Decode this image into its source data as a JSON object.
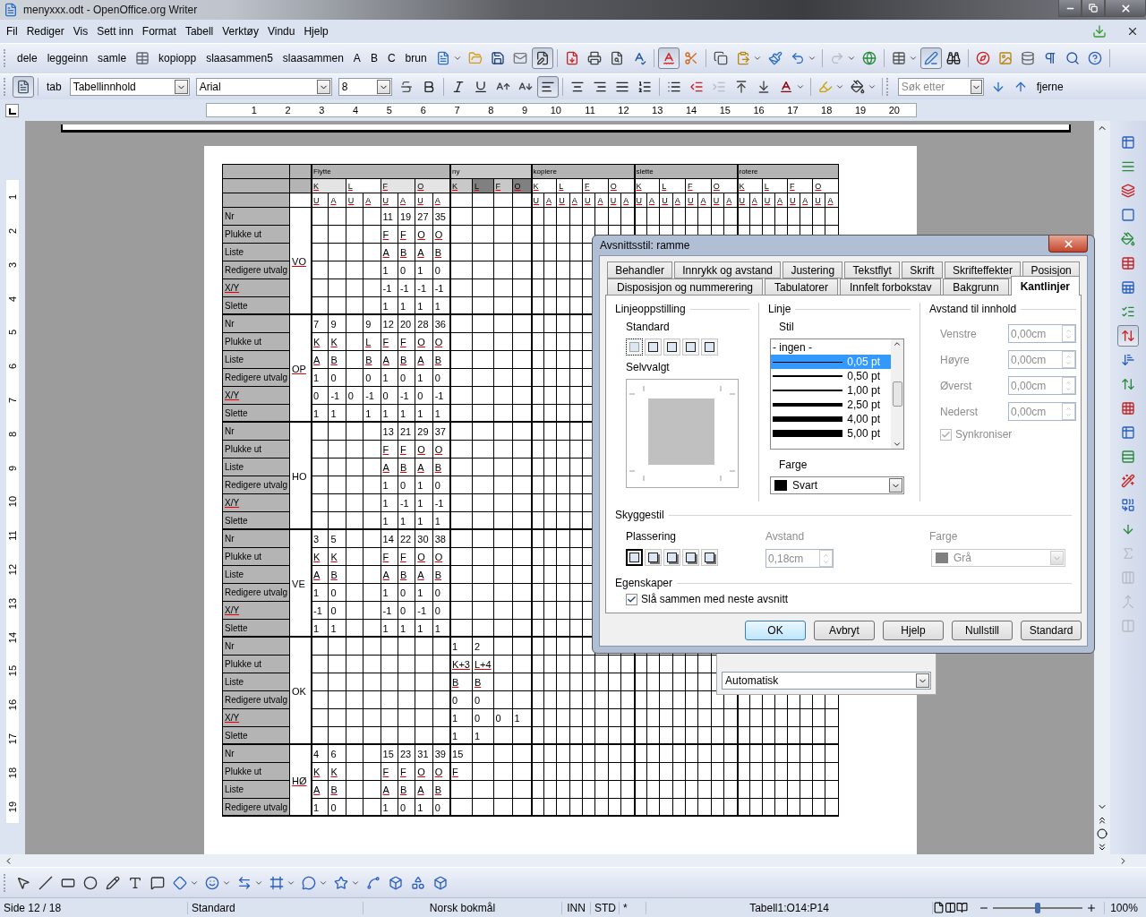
{
  "window": {
    "title": "menyxxx.odt - OpenOffice.org Writer"
  },
  "menu": [
    "Fil",
    "Rediger",
    "Vis",
    "Sett inn",
    "Format",
    "Tabell",
    "Verktøy",
    "Vindu",
    "Hjelp"
  ],
  "toolbar_1": {
    "text_buttons_a": [
      "dele",
      "leggeinn",
      "samle"
    ],
    "text_buttons_b": [
      "kopiopp",
      "slaasammen5",
      "slaasammen",
      "A",
      "B",
      "C",
      "brun"
    ],
    "icon_buttons": [
      {
        "on": false,
        "disabled": false
      },
      {
        "on": false,
        "disabled": false
      },
      {
        "on": false,
        "disabled": false
      },
      {
        "on": false,
        "disabled": false
      },
      {
        "on": true,
        "disabled": false
      },
      {
        "on": false,
        "disabled": false
      },
      {
        "on": false,
        "disabled": false
      },
      {
        "on": false,
        "disabled": false
      },
      {
        "on": false,
        "disabled": false
      },
      {
        "on": true,
        "disabled": false
      },
      {
        "on": false,
        "disabled": false
      },
      {
        "on": false,
        "disabled": false
      },
      {
        "on": false,
        "disabled": false
      },
      {
        "on": false,
        "disabled": false
      },
      {
        "on": false,
        "disabled": false
      },
      {
        "on": false,
        "disabled": true
      },
      {
        "on": false,
        "disabled": false
      },
      {
        "on": false,
        "disabled": false
      },
      {
        "on": true,
        "disabled": false
      },
      {
        "on": false,
        "disabled": false
      },
      {
        "on": false,
        "disabled": false
      },
      {
        "on": false,
        "disabled": false
      },
      {
        "on": false,
        "disabled": false
      },
      {
        "on": false,
        "disabled": false
      },
      {
        "on": false,
        "disabled": false
      },
      {
        "on": false,
        "disabled": false
      }
    ]
  },
  "toolbar_2": {
    "first_button_on": true,
    "tool_label": "tab",
    "style": "Tabellinnhold",
    "font": "Arial",
    "size": "8",
    "icon_buttons": [
      {
        "on": false,
        "disabled": false
      },
      {
        "on": false,
        "disabled": false
      },
      {
        "on": false,
        "disabled": false
      },
      {
        "on": false,
        "disabled": false
      },
      {
        "on": false,
        "disabled": false
      },
      {
        "on": false,
        "disabled": false
      },
      {
        "on": true,
        "disabled": false
      },
      {
        "on": false,
        "disabled": false
      },
      {
        "on": false,
        "disabled": false
      },
      {
        "on": false,
        "disabled": false
      },
      {
        "on": false,
        "disabled": false
      },
      {
        "on": false,
        "disabled": false
      },
      {
        "on": false,
        "disabled": false
      },
      {
        "on": false,
        "disabled": true
      },
      {
        "on": false,
        "disabled": false
      },
      {
        "on": false,
        "disabled": false
      },
      {
        "on": false,
        "disabled": false
      },
      {
        "on": false,
        "disabled": false
      },
      {
        "on": false,
        "disabled": false
      }
    ]
  },
  "find_toolbar": {
    "placeholder": "Søk etter",
    "button": "fjerne"
  },
  "ruler": {
    "labels": [
      "1",
      "2",
      "3",
      "4",
      "5",
      "6",
      "7",
      "8",
      "9",
      "10",
      "11",
      "12",
      "13",
      "14",
      "15",
      "16",
      "17",
      "18",
      "19",
      "20"
    ]
  },
  "vertical_ruler": {
    "labels": [
      "1",
      "2",
      "3",
      "4",
      "5",
      "6",
      "7",
      "8",
      "9",
      "10",
      "11",
      "12",
      "13",
      "14",
      "15",
      "16",
      "17",
      "18",
      "19"
    ]
  },
  "table": {
    "groups": [
      {
        "label": "Flytte",
        "subgroups": [
          {
            "label": "K",
            "kind": "light",
            "halves": [
              "U",
              "A"
            ]
          },
          {
            "label": "L",
            "kind": "white",
            "halves": [
              "U",
              "A"
            ]
          },
          {
            "label": "F",
            "kind": "light",
            "halves": [
              "U",
              "A"
            ]
          },
          {
            "label": "O",
            "kind": "light",
            "halves": [
              "U",
              "A"
            ]
          }
        ]
      },
      {
        "label": "ny",
        "subgroups": [
          {
            "label": "K",
            "kind": "mid"
          },
          {
            "label": "L",
            "kind": "dark"
          },
          {
            "label": "F",
            "kind": "mid"
          },
          {
            "label": "O",
            "kind": "dark"
          }
        ]
      },
      {
        "label": "kopiere",
        "subgroups": [
          {
            "label": "K",
            "kind": "white",
            "halves": [
              "U",
              "A"
            ]
          },
          {
            "label": "L",
            "kind": "white",
            "halves": [
              "U",
              "A"
            ]
          },
          {
            "label": "F",
            "kind": "white",
            "halves": [
              "U",
              "A"
            ]
          },
          {
            "label": "O",
            "kind": "white",
            "halves": [
              "U",
              "A"
            ]
          }
        ]
      },
      {
        "label": "slette",
        "subgroups": [
          {
            "label": "K",
            "kind": "white",
            "halves": [
              "U",
              "A"
            ]
          },
          {
            "label": "L",
            "kind": "white",
            "halves": [
              "U",
              "A"
            ]
          },
          {
            "label": "F",
            "kind": "white",
            "halves": [
              "U",
              "A"
            ]
          },
          {
            "label": "O",
            "kind": "white",
            "halves": [
              "U",
              "A"
            ]
          }
        ]
      },
      {
        "label": "rotere",
        "subgroups": [
          {
            "label": "K",
            "kind": "white",
            "halves": [
              "U",
              "A"
            ]
          },
          {
            "label": "L",
            "kind": "white",
            "halves": [
              "U",
              "A"
            ]
          },
          {
            "label": "F",
            "kind": "white",
            "halves": [
              "U",
              "A"
            ]
          },
          {
            "label": "O",
            "kind": "white",
            "halves": [
              "U",
              "A"
            ]
          }
        ]
      }
    ],
    "sections": [
      {
        "label": "VO",
        "spellcheck": true,
        "rows": [
          {
            "label": "Nr",
            "label_spellcheck": false,
            "cells_spellcheck": false,
            "cells": [
              null,
              null,
              null,
              null,
              "11",
              "19",
              "27",
              "35"
            ]
          },
          {
            "label": "Plukke ut",
            "label_spellcheck": false,
            "cells_spellcheck": true,
            "cells": [
              null,
              null,
              null,
              null,
              "F",
              "F",
              "O",
              "O"
            ]
          },
          {
            "label": "Liste",
            "label_spellcheck": false,
            "cells_spellcheck": true,
            "cells": [
              null,
              null,
              null,
              null,
              "A",
              "B",
              "A",
              "B"
            ]
          },
          {
            "label": "Redigere utvalg",
            "label_spellcheck": false,
            "cells_spellcheck": false,
            "cells": [
              null,
              null,
              null,
              null,
              "1",
              "0",
              "1",
              "0"
            ]
          },
          {
            "label": "X/Y",
            "label_spellcheck": true,
            "cells_spellcheck": false,
            "cells": [
              null,
              null,
              null,
              null,
              "-1",
              "-1",
              "-1",
              "-1"
            ]
          },
          {
            "label": "Slette",
            "label_spellcheck": false,
            "cells_spellcheck": false,
            "cells": [
              null,
              null,
              null,
              null,
              "1",
              "1",
              "1",
              "1"
            ]
          }
        ]
      },
      {
        "label": "OP",
        "spellcheck": true,
        "rows": [
          {
            "label": "Nr",
            "label_spellcheck": false,
            "cells_spellcheck": false,
            "cells": [
              "7",
              "9",
              null,
              "9",
              "12",
              "20",
              "28",
              "36"
            ]
          },
          {
            "label": "Plukke ut",
            "label_spellcheck": false,
            "cells_spellcheck": true,
            "cells": [
              "K",
              "K",
              null,
              "L",
              "F",
              "F",
              "O",
              "O"
            ]
          },
          {
            "label": "Liste",
            "label_spellcheck": false,
            "cells_spellcheck": true,
            "cells": [
              "A",
              "B",
              null,
              "B",
              "A",
              "B",
              "A",
              "B"
            ]
          },
          {
            "label": "Redigere utvalg",
            "label_spellcheck": false,
            "cells_spellcheck": false,
            "cells": [
              "1",
              "0",
              null,
              "0",
              "1",
              "0",
              "1",
              "0"
            ]
          },
          {
            "label": "X/Y",
            "label_spellcheck": true,
            "cells_spellcheck": false,
            "cells": [
              "0",
              "-1",
              "0",
              "-1",
              "0",
              "-1",
              "0",
              "-1"
            ]
          },
          {
            "label": "Slette",
            "label_spellcheck": false,
            "cells_spellcheck": false,
            "cells": [
              "1",
              "1",
              null,
              "1",
              "1",
              "1",
              "1",
              "1"
            ]
          }
        ]
      },
      {
        "label": "HO",
        "spellcheck": false,
        "rows": [
          {
            "label": "Nr",
            "label_spellcheck": false,
            "cells_spellcheck": false,
            "cells": [
              null,
              null,
              null,
              null,
              "13",
              "21",
              "29",
              "37"
            ]
          },
          {
            "label": "Plukke ut",
            "label_spellcheck": false,
            "cells_spellcheck": true,
            "cells": [
              null,
              null,
              null,
              null,
              "F",
              "F",
              "O",
              "O"
            ]
          },
          {
            "label": "Liste",
            "label_spellcheck": false,
            "cells_spellcheck": true,
            "cells": [
              null,
              null,
              null,
              null,
              "A",
              "B",
              "A",
              "B"
            ]
          },
          {
            "label": "Redigere utvalg",
            "label_spellcheck": false,
            "cells_spellcheck": false,
            "cells": [
              null,
              null,
              null,
              null,
              "1",
              "0",
              "1",
              "0"
            ]
          },
          {
            "label": "X/Y",
            "label_spellcheck": true,
            "cells_spellcheck": false,
            "cells": [
              null,
              null,
              null,
              null,
              "1",
              "-1",
              "1",
              "-1"
            ]
          },
          {
            "label": "Slette",
            "label_spellcheck": false,
            "cells_spellcheck": false,
            "cells": [
              null,
              null,
              null,
              null,
              "1",
              "1",
              "1",
              "1"
            ]
          }
        ]
      },
      {
        "label": "VE",
        "spellcheck": false,
        "rows": [
          {
            "label": "Nr",
            "label_spellcheck": false,
            "cells_spellcheck": false,
            "cells": [
              "3",
              "5",
              null,
              null,
              "14",
              "22",
              "30",
              "38"
            ]
          },
          {
            "label": "Plukke ut",
            "label_spellcheck": false,
            "cells_spellcheck": true,
            "cells": [
              "K",
              "K",
              null,
              null,
              "F",
              "F",
              "O",
              "O"
            ]
          },
          {
            "label": "Liste",
            "label_spellcheck": false,
            "cells_spellcheck": true,
            "cells": [
              "A",
              "B",
              null,
              null,
              "A",
              "B",
              "A",
              "B"
            ]
          },
          {
            "label": "Redigere utvalg",
            "label_spellcheck": false,
            "cells_spellcheck": false,
            "cells": [
              "1",
              "0",
              null,
              null,
              "1",
              "0",
              "1",
              "0"
            ]
          },
          {
            "label": "X/Y",
            "label_spellcheck": true,
            "cells_spellcheck": false,
            "cells": [
              "-1",
              "0",
              null,
              null,
              "-1",
              "0",
              "-1",
              "0"
            ]
          },
          {
            "label": "Slette",
            "label_spellcheck": false,
            "cells_spellcheck": false,
            "cells": [
              "1",
              "1",
              null,
              null,
              "1",
              "1",
              "1",
              "1"
            ]
          }
        ]
      },
      {
        "label": "OK",
        "spellcheck": false,
        "rows": [
          {
            "label": "Nr",
            "label_spellcheck": false,
            "cells_spellcheck": false,
            "cells": [
              null,
              null,
              null,
              null,
              null,
              null,
              null,
              null,
              "1",
              "2"
            ]
          },
          {
            "label": "Plukke ut",
            "label_spellcheck": false,
            "cells_spellcheck": true,
            "cells": [
              null,
              null,
              null,
              null,
              null,
              null,
              null,
              null,
              "K+3",
              "L+4"
            ]
          },
          {
            "label": "Liste",
            "label_spellcheck": false,
            "cells_spellcheck": true,
            "cells": [
              null,
              null,
              null,
              null,
              null,
              null,
              null,
              null,
              "B",
              "B"
            ]
          },
          {
            "label": "Redigere utvalg",
            "label_spellcheck": false,
            "cells_spellcheck": false,
            "cells": [
              null,
              null,
              null,
              null,
              null,
              null,
              null,
              null,
              "0",
              "0"
            ]
          },
          {
            "label": "X/Y",
            "label_spellcheck": true,
            "cells_spellcheck": false,
            "cells": [
              null,
              null,
              null,
              null,
              null,
              null,
              null,
              null,
              "1",
              "0",
              "0",
              "1"
            ]
          },
          {
            "label": "Slette",
            "label_spellcheck": false,
            "cells_spellcheck": false,
            "cells": [
              null,
              null,
              null,
              null,
              null,
              null,
              null,
              null,
              "1",
              "1"
            ]
          }
        ]
      },
      {
        "label": "HØ",
        "spellcheck": true,
        "rows": [
          {
            "label": "Nr",
            "label_spellcheck": false,
            "cells_spellcheck": false,
            "cells": [
              "4",
              "6",
              null,
              null,
              "15",
              "23",
              "31",
              "39",
              "15"
            ]
          },
          {
            "label": "Plukke ut",
            "label_spellcheck": false,
            "cells_spellcheck": true,
            "cells": [
              "K",
              "K",
              null,
              null,
              "F",
              "F",
              "O",
              "O",
              "F"
            ]
          },
          {
            "label": "Liste",
            "label_spellcheck": false,
            "cells_spellcheck": true,
            "cells": [
              "A",
              "B",
              null,
              null,
              "A",
              "B",
              "A",
              "B"
            ]
          },
          {
            "label": "Redigere utvalg",
            "label_spellcheck": false,
            "cells_spellcheck": false,
            "cells": [
              "1",
              "0",
              null,
              null,
              "1",
              "0",
              "1",
              "0"
            ]
          }
        ]
      }
    ]
  },
  "background_panel": {
    "dropdown": "Automatisk"
  },
  "dialog": {
    "title": "Avsnittsstil: ramme",
    "tab_rows": [
      [
        {
          "label": "Behandler",
          "selected": false
        },
        {
          "label": "Innrykk og avstand",
          "selected": false
        },
        {
          "label": "Justering",
          "selected": false
        },
        {
          "label": "Tekstflyt",
          "selected": false
        },
        {
          "label": "Skrift",
          "selected": false
        },
        {
          "label": "Skrifteffekter",
          "selected": false
        },
        {
          "label": "Posisjon",
          "selected": false
        }
      ],
      [
        {
          "label": "Disposisjon og nummerering",
          "selected": false
        },
        {
          "label": "Tabulatorer",
          "selected": false
        },
        {
          "label": "Innfelt forbokstav",
          "selected": false
        },
        {
          "label": "Bakgrunn",
          "selected": false
        },
        {
          "label": "Kantlinjer",
          "selected": true
        }
      ]
    ],
    "line_arrangement": {
      "heading": "Linjeoppstilling",
      "presets_label": "Standard",
      "presets": [
        {
          "selected": true
        },
        {
          "selected": false
        },
        {
          "selected": false
        },
        {
          "selected": false
        },
        {
          "selected": false
        }
      ],
      "custom_label": "Selvvalgt"
    },
    "line": {
      "heading": "Linje",
      "style_label": "Stil",
      "styles": [
        {
          "label": "- ingen -",
          "kind": "none",
          "selected": false
        },
        {
          "label": "0,05 pt",
          "kind": "hairline",
          "selected": true
        },
        {
          "label": "0,50 pt",
          "kind": "thin",
          "selected": false
        },
        {
          "label": "1,00 pt",
          "kind": "medium",
          "selected": false
        },
        {
          "label": "2,50 pt",
          "kind": "thick",
          "selected": false
        },
        {
          "label": "4,00 pt",
          "kind": "heavy",
          "selected": false
        },
        {
          "label": "5,00 pt",
          "kind": "heaviest",
          "selected": false
        }
      ],
      "color_label": "Farge",
      "color": {
        "name": "Svart",
        "color": "#000000"
      }
    },
    "padding": {
      "heading": "Avstand til innhold",
      "fields": [
        {
          "label": "Venstre",
          "value": "0,00cm",
          "disabled": true
        },
        {
          "label": "Høyre",
          "value": "0,00cm",
          "disabled": true
        },
        {
          "label": "Øverst",
          "value": "0,00cm",
          "disabled": true
        },
        {
          "label": "Nederst",
          "value": "0,00cm",
          "disabled": true
        }
      ],
      "sync": {
        "label": "Synkroniser",
        "checked": true,
        "disabled": true
      }
    },
    "shadow": {
      "heading": "Skyggestil",
      "position_label": "Plassering",
      "positions": [
        {
          "selected": true
        },
        {
          "selected": false
        },
        {
          "selected": false
        },
        {
          "selected": false
        },
        {
          "selected": false
        }
      ],
      "distance": {
        "label": "Avstand",
        "value": "0,18cm",
        "disabled": true
      },
      "color": {
        "label": "Farge",
        "value": "Grå",
        "color": "#808080",
        "disabled": true
      }
    },
    "properties": {
      "heading": "Egenskaper",
      "merge": {
        "label": "Slå sammen med neste avsnitt",
        "checked": true
      }
    },
    "buttons": [
      {
        "label": "OK",
        "default": true
      },
      {
        "label": "Avbryt",
        "default": false
      },
      {
        "label": "Hjelp",
        "default": false
      },
      {
        "label": "Nullstill",
        "default": false
      },
      {
        "label": "Standard",
        "default": false
      }
    ]
  },
  "sidebar": {
    "tools": [
      {
        "on": false,
        "disabled": false
      },
      {
        "on": false,
        "disabled": false
      },
      {
        "on": false,
        "disabled": false
      },
      {
        "on": false,
        "disabled": false
      },
      {
        "on": false,
        "disabled": false
      },
      {
        "on": false,
        "disabled": false
      },
      {
        "on": false,
        "disabled": false
      },
      {
        "on": false,
        "disabled": false
      },
      {
        "on": true,
        "disabled": false
      },
      {
        "on": false,
        "disabled": false
      },
      {
        "on": false,
        "disabled": false
      },
      {
        "on": false,
        "disabled": false
      },
      {
        "on": false,
        "disabled": false
      },
      {
        "on": false,
        "disabled": false
      },
      {
        "on": false,
        "disabled": false
      },
      {
        "on": false,
        "disabled": false
      },
      {
        "on": false,
        "disabled": false
      },
      {
        "on": false,
        "disabled": true
      },
      {
        "on": false,
        "disabled": true
      },
      {
        "on": false,
        "disabled": true
      },
      {
        "on": false,
        "disabled": true
      }
    ]
  },
  "status_bar": {
    "page": "Side 12 / 18",
    "style": "Standard",
    "language": "Norsk bokmål",
    "insert_mode": "INN",
    "selection_mode": "STD",
    "modified": "*",
    "cell": "Tabell1:O14:P14",
    "zoom": {
      "level": 0.5,
      "reading": "100%"
    }
  }
}
